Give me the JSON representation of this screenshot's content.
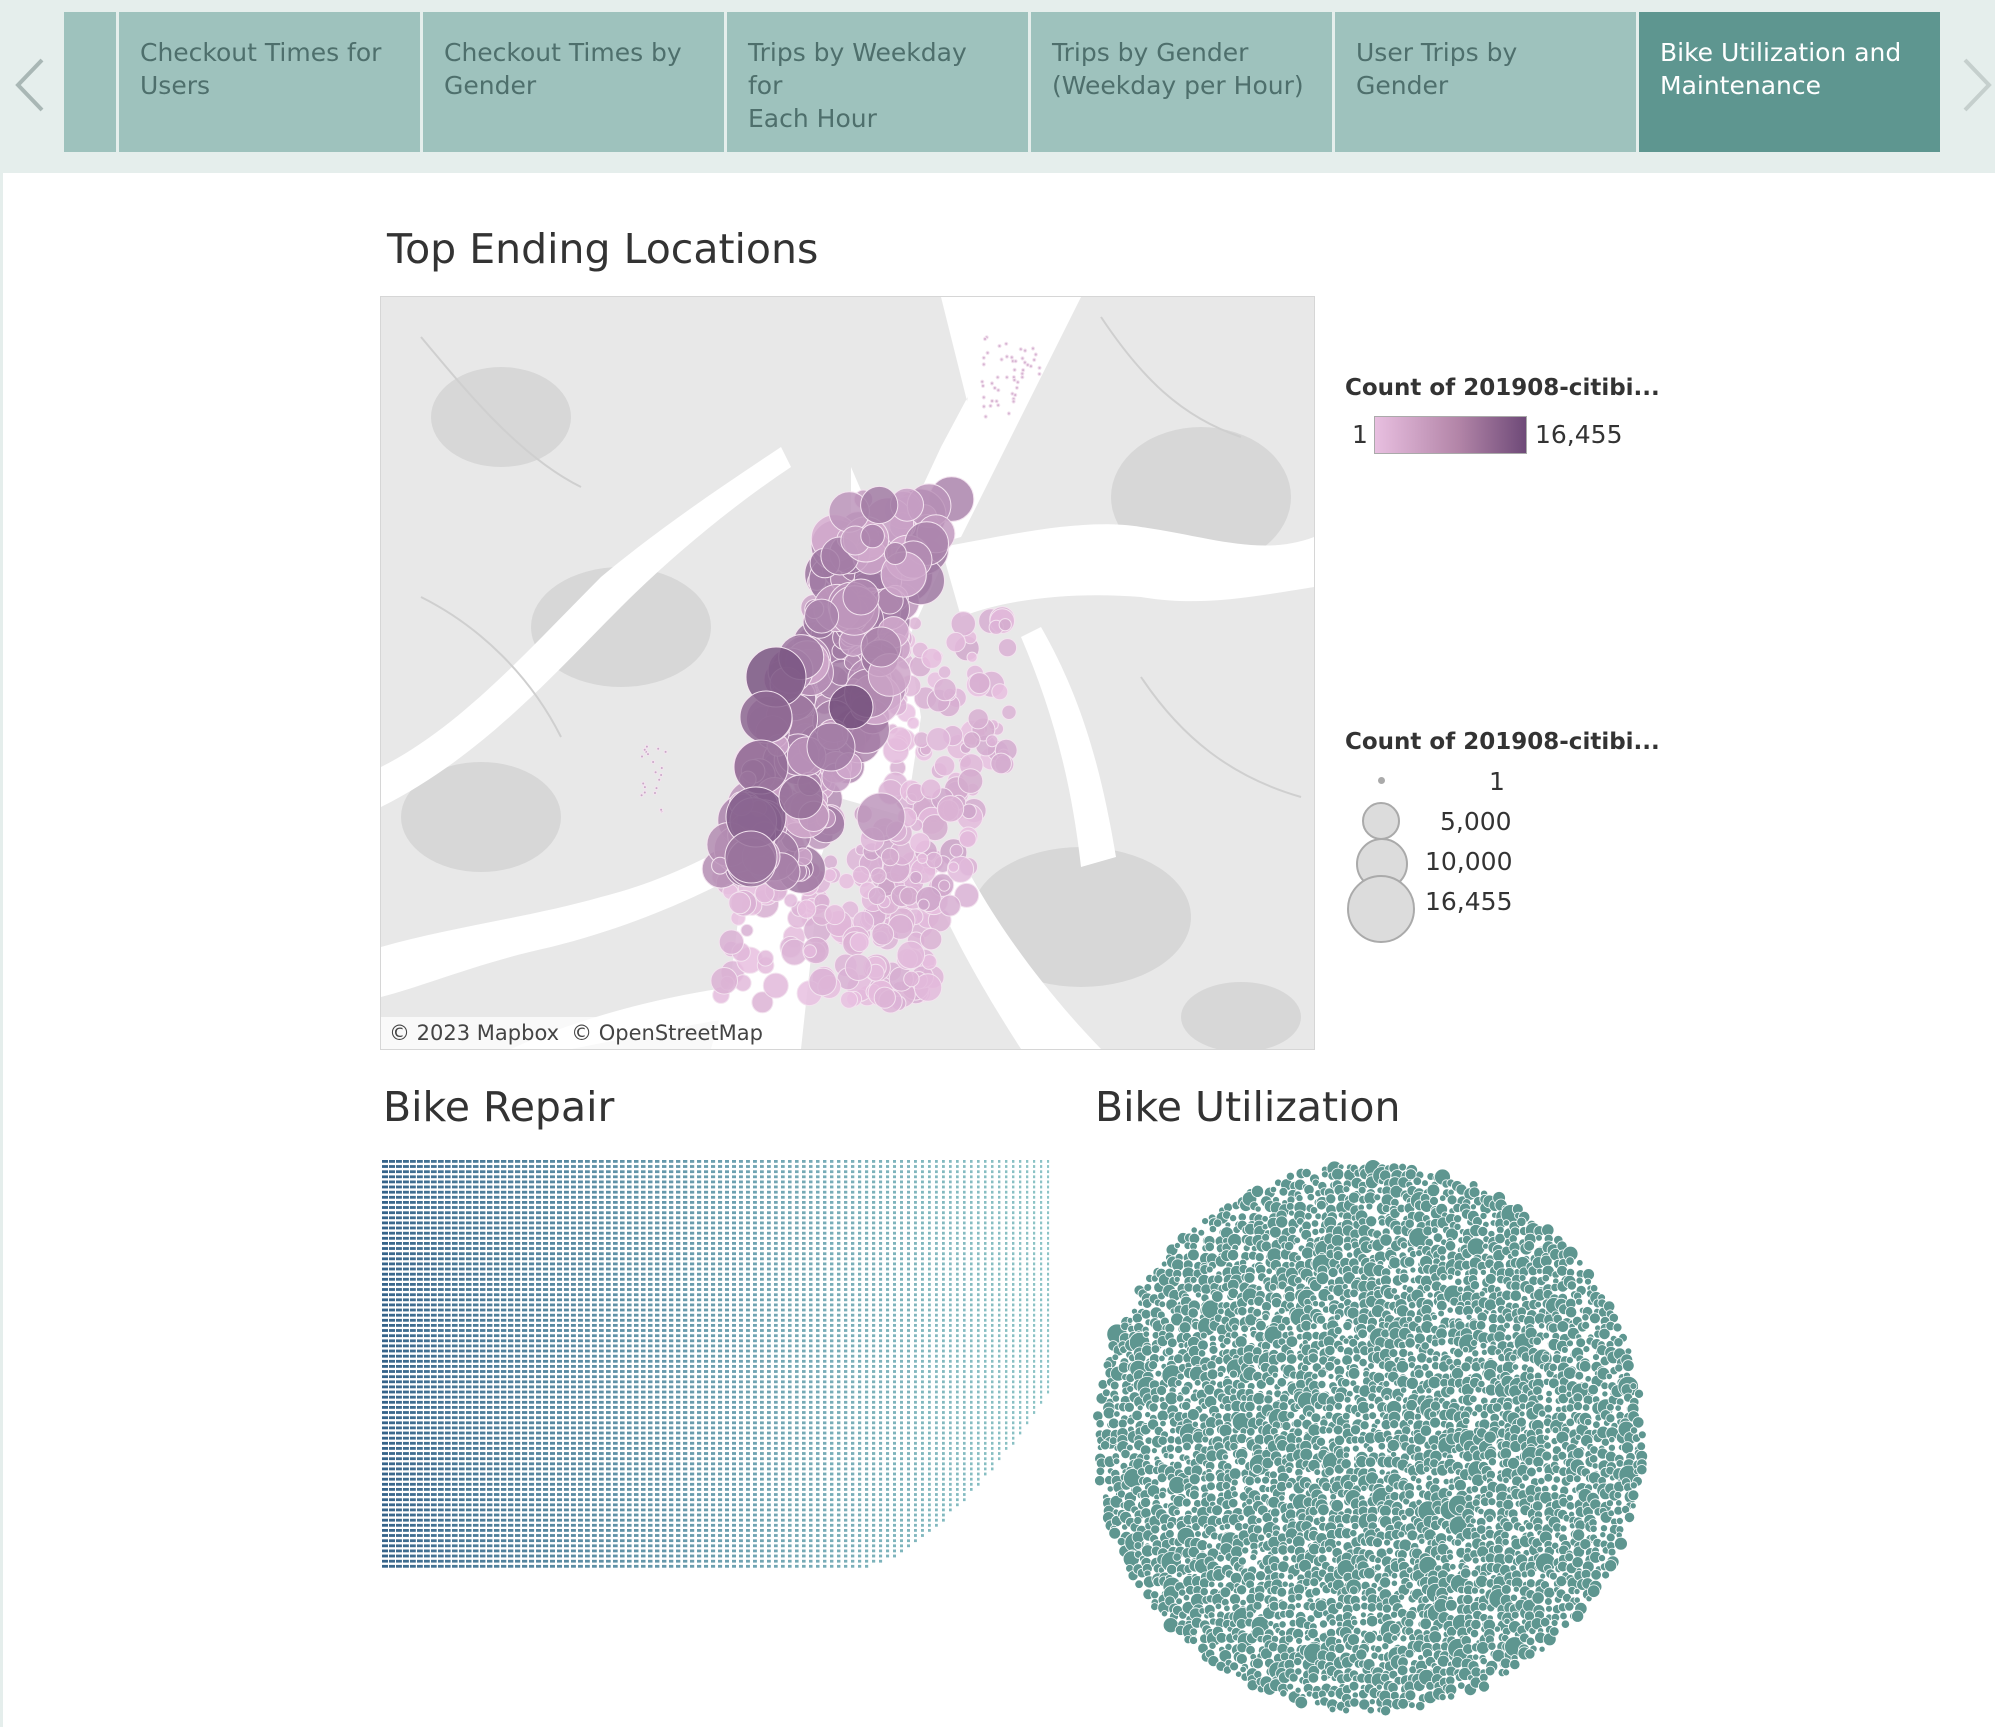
{
  "nav": {
    "tabs": [
      {
        "label": "Checkout Times for\nUsers",
        "active": false
      },
      {
        "label": "Checkout Times by\nGender",
        "active": false
      },
      {
        "label": "Trips by Weekday for\nEach Hour",
        "active": false
      },
      {
        "label": "Trips by Gender\n(Weekday per Hour)",
        "active": false
      },
      {
        "label": "User Trips by Gender",
        "active": false
      },
      {
        "label": "Bike Utilization and\nMaintenance",
        "active": true
      }
    ],
    "arrow_icons": [
      "chevron-left-icon",
      "chevron-right-icon"
    ]
  },
  "map_section": {
    "title": "Top Ending Locations",
    "attribution": [
      "© 2023 Mapbox",
      "© OpenStreetMap"
    ],
    "color_legend": {
      "title": "Count of 201908-citibi...",
      "min_label": "1",
      "max_label": "16,455",
      "colors": [
        "#e8bfe0",
        "#6e4a78"
      ]
    },
    "size_legend": {
      "title": "Count of 201908-citibi...",
      "items": [
        "1",
        "5,000",
        "10,000",
        "16,455"
      ]
    }
  },
  "repair": {
    "title": "Bike Repair",
    "colors": [
      "#37648a",
      "#8cc4c6"
    ]
  },
  "utilization": {
    "title": "Bike Utilization",
    "color": "#5e9690"
  }
}
